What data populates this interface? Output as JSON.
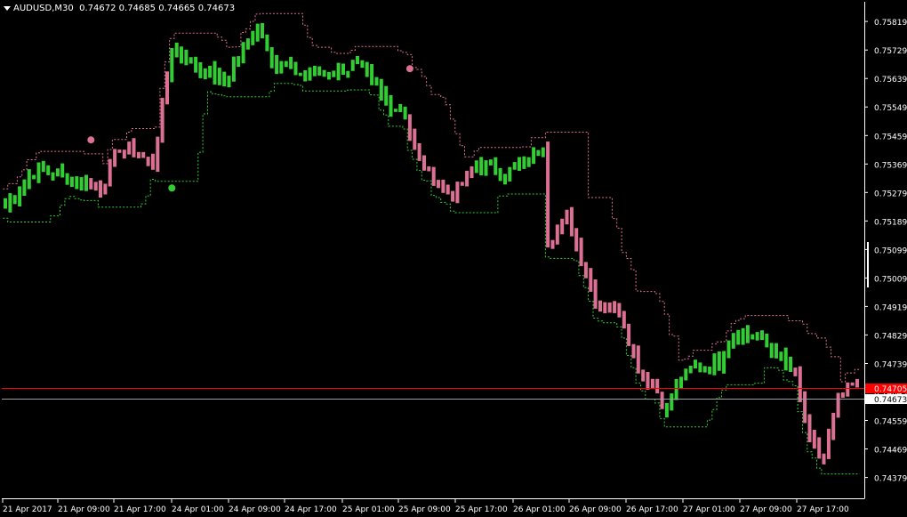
{
  "header": {
    "symbol": "AUDUSD,M30",
    "ohlc": "0.74672 0.74685 0.74665 0.74673"
  },
  "colors": {
    "background": "#000000",
    "axis": "#ffffff",
    "bull": "#32cd32",
    "bear": "#db7093",
    "bid_line": "#ff0000",
    "bid_label_bg": "#ff0000",
    "current_label_bg": "#ffffff",
    "current_line": "#9aa0a6"
  },
  "chart_data": {
    "type": "bar",
    "symbol": "AUDUSD",
    "timeframe": "M30",
    "ylim": [
      0.7433,
      0.7587
    ],
    "y_ticks": [
      "0.75819",
      "0.75729",
      "0.75639",
      "0.75549",
      "0.75459",
      "0.75369",
      "0.75279",
      "0.75189",
      "0.75099",
      "0.75009",
      "0.74919",
      "0.74829",
      "0.74739",
      "0.74649",
      "0.74559",
      "0.74469",
      "0.74379"
    ],
    "x_ticks": [
      "21 Apr 2017",
      "21 Apr 09:00",
      "21 Apr 17:00",
      "24 Apr 01:00",
      "24 Apr 09:00",
      "24 Apr 17:00",
      "25 Apr 01:00",
      "25 Apr 09:00",
      "25 Apr 17:00",
      "26 Apr 01:00",
      "26 Apr 09:00",
      "26 Apr 17:00",
      "27 Apr 01:00",
      "27 Apr 09:00",
      "27 Apr 17:00"
    ],
    "price_labels": {
      "red_line": "0.74705",
      "current": "0.74673"
    },
    "waypoints": [
      [
        0,
        0.7523
      ],
      [
        6,
        0.7535
      ],
      [
        13,
        0.7533
      ],
      [
        20,
        0.7529
      ],
      [
        24,
        0.7542
      ],
      [
        28,
        0.754
      ],
      [
        31,
        0.7536
      ],
      [
        35,
        0.7574
      ],
      [
        41,
        0.7567
      ],
      [
        46,
        0.7563
      ],
      [
        50,
        0.7573
      ],
      [
        53,
        0.7581
      ],
      [
        57,
        0.7568
      ],
      [
        64,
        0.7565
      ],
      [
        69,
        0.7566
      ],
      [
        74,
        0.7568
      ],
      [
        80,
        0.7557
      ],
      [
        84,
        0.7553
      ],
      [
        86,
        0.7541
      ],
      [
        89,
        0.7534
      ],
      [
        94,
        0.7527
      ],
      [
        99,
        0.7537
      ],
      [
        105,
        0.7534
      ],
      [
        111,
        0.7539
      ],
      [
        113,
        0.7544
      ],
      [
        114,
        0.7513
      ],
      [
        118,
        0.752
      ],
      [
        124,
        0.7494
      ],
      [
        129,
        0.7491
      ],
      [
        133,
        0.7473
      ],
      [
        137,
        0.7465
      ],
      [
        139,
        0.7458
      ],
      [
        141,
        0.7468
      ],
      [
        145,
        0.7473
      ],
      [
        150,
        0.7474
      ],
      [
        153,
        0.7484
      ],
      [
        158,
        0.7482
      ],
      [
        162,
        0.7477
      ],
      [
        166,
        0.747
      ],
      [
        169,
        0.7449
      ],
      [
        172,
        0.7444
      ],
      [
        175,
        0.7462
      ],
      [
        178,
        0.7467
      ]
    ],
    "arrows": [
      {
        "bar": 18,
        "price": 0.75445,
        "color": "#db7093"
      },
      {
        "bar": 35,
        "price": 0.75293,
        "color": "#32cd32"
      },
      {
        "bar": 85,
        "price": 0.7567,
        "color": "#db7093"
      }
    ]
  }
}
